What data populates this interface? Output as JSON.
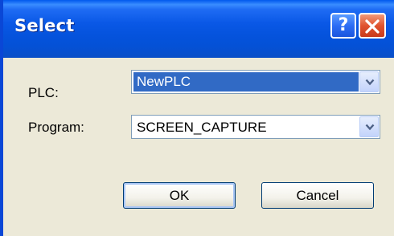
{
  "window": {
    "title": "Select",
    "help_glyph": "?"
  },
  "form": {
    "plc_label": "PLC:",
    "plc_value": "NewPLC",
    "program_label": "Program:",
    "program_value": "SCREEN_CAPTURE"
  },
  "buttons": {
    "ok_label": "OK",
    "cancel_label": "Cancel"
  },
  "icons": {
    "help": "question-mark-icon",
    "close": "close-x-icon",
    "dropdown": "chevron-down-icon"
  },
  "colors": {
    "titlebar": "#0553dd",
    "close_button": "#e0532f",
    "selection": "#316ac5",
    "dialog_background": "#ece9d8"
  }
}
